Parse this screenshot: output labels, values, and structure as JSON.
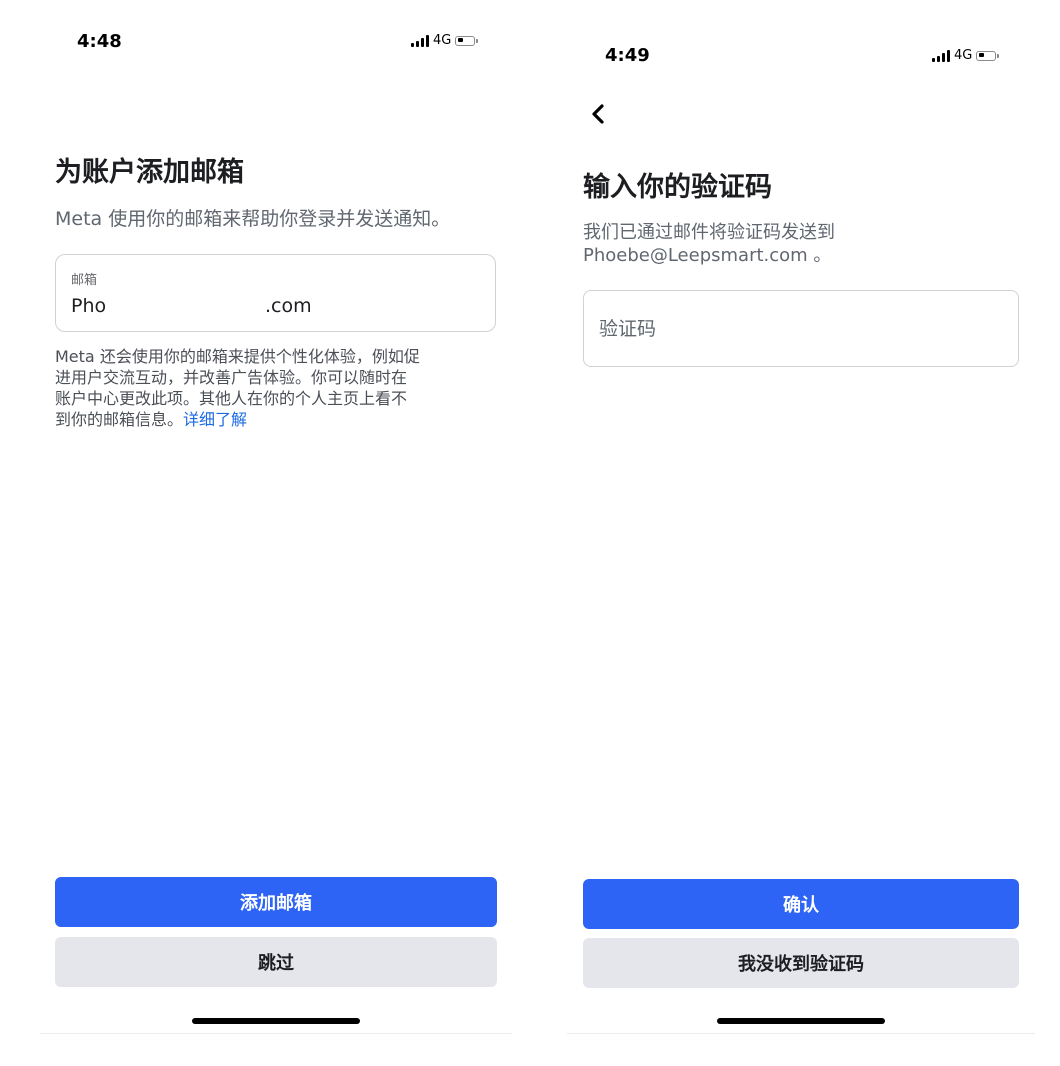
{
  "left_screen": {
    "status_bar": {
      "time": "4:48",
      "network": "4G"
    },
    "title": "为账户添加邮箱",
    "subtitle": "Meta 使用你的邮箱来帮助你登录并发送通知。",
    "email_field": {
      "label": "邮箱",
      "value_prefix": "Pho",
      "value_suffix": ".com"
    },
    "info": {
      "line1": "Meta 还会使用你的邮箱来提供个性化体验，例如促",
      "line2": "进用户交流互动，并改善广告体验。你可以随时在",
      "line3": "账户中心更改此项。其他人在你的个人主页上看不",
      "line4": "到你的邮箱信息。",
      "link": "详细了解"
    },
    "primary_button": "添加邮箱",
    "secondary_button": "跳过"
  },
  "right_screen": {
    "status_bar": {
      "time": "4:49",
      "network": "4G"
    },
    "title": "输入你的验证码",
    "description_line1": "我们已通过邮件将验证码发送到",
    "description_line2": "Phoebe@Leepsmart.com 。",
    "code_field": {
      "placeholder": "验证码"
    },
    "primary_button": "确认",
    "secondary_button": "我没收到验证码"
  },
  "colors": {
    "primary_button": "#2d64f5",
    "secondary_button": "#e4e6eb",
    "link": "#1d6ae5",
    "text": "#1c1e21",
    "muted_text": "#606770"
  },
  "icons": [
    "signal-icon",
    "battery-icon",
    "back-arrow-icon",
    "home-indicator"
  ]
}
